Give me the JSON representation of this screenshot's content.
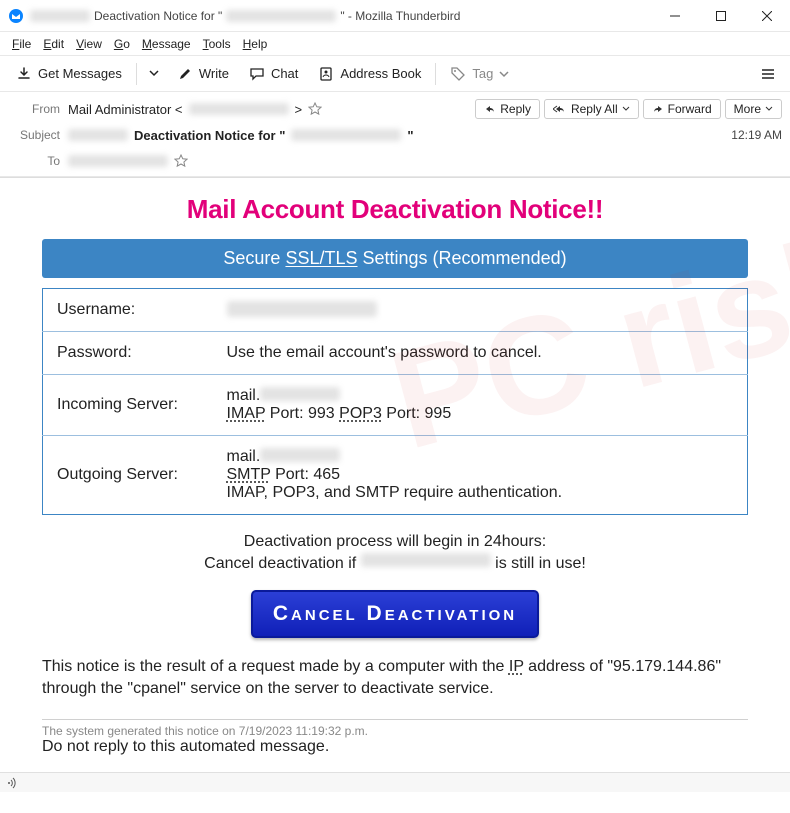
{
  "window": {
    "title_prefix": "Deactivation Notice for \"",
    "title_suffix": "\" - Mozilla Thunderbird"
  },
  "menu": {
    "file": "File",
    "edit": "Edit",
    "view": "View",
    "go": "Go",
    "message": "Message",
    "tools": "Tools",
    "help": "Help"
  },
  "toolbar": {
    "get_messages": "Get Messages",
    "write": "Write",
    "chat": "Chat",
    "address_book": "Address Book",
    "tag": "Tag"
  },
  "header": {
    "from_label": "From",
    "from_name": "Mail Administrator <",
    "from_suffix": ">",
    "subject_label": "Subject",
    "subject_bold": "Deactivation Notice for \"",
    "subject_suffix": "\"",
    "to_label": "To",
    "reply": "Reply",
    "reply_all": "Reply All",
    "forward": "Forward",
    "more": "More",
    "time": "12:19 AM"
  },
  "body": {
    "title": "Mail Account Deactivation Notice!!",
    "banner_pre": "Secure  ",
    "banner_mid": "SSL/TLS",
    "banner_post": " Settings (Recommended)",
    "username_label": "Username:",
    "password_label": "Password:",
    "password_value": "Use the email account's password to cancel.",
    "incoming_label": "Incoming Server:",
    "incoming_mail_prefix": "mail.",
    "incoming_ports_imap": "IMAP",
    "incoming_ports_imap_val": " Port: 993   ",
    "incoming_ports_pop3": "POP3",
    "incoming_ports_pop3_val": " Port: 995",
    "outgoing_label": "Outgoing Server:",
    "outgoing_mail_prefix": "mail.",
    "outgoing_smtp": "SMTP",
    "outgoing_smtp_val": " Port: 465",
    "outgoing_auth": "IMAP, POP3, and SMTP require authentication.",
    "warn_line1": "Deactivation process will begin in 24hours:",
    "warn_line2_pre": "Cancel deactivation if ",
    "warn_line2_post": " is still in use!",
    "cancel_btn": "Cancel Deactivation",
    "notice_pre": "This notice is the result of a request made by a computer with the  ",
    "notice_ip_label": "IP",
    "notice_post": " address of \"95.179.144.86\" through the \"cpanel\" service on the server to deactivate service.",
    "generated": "The system generated this notice on 7/19/2023 11:19:32 p.m.",
    "noreply": "Do not reply to this automated message."
  }
}
